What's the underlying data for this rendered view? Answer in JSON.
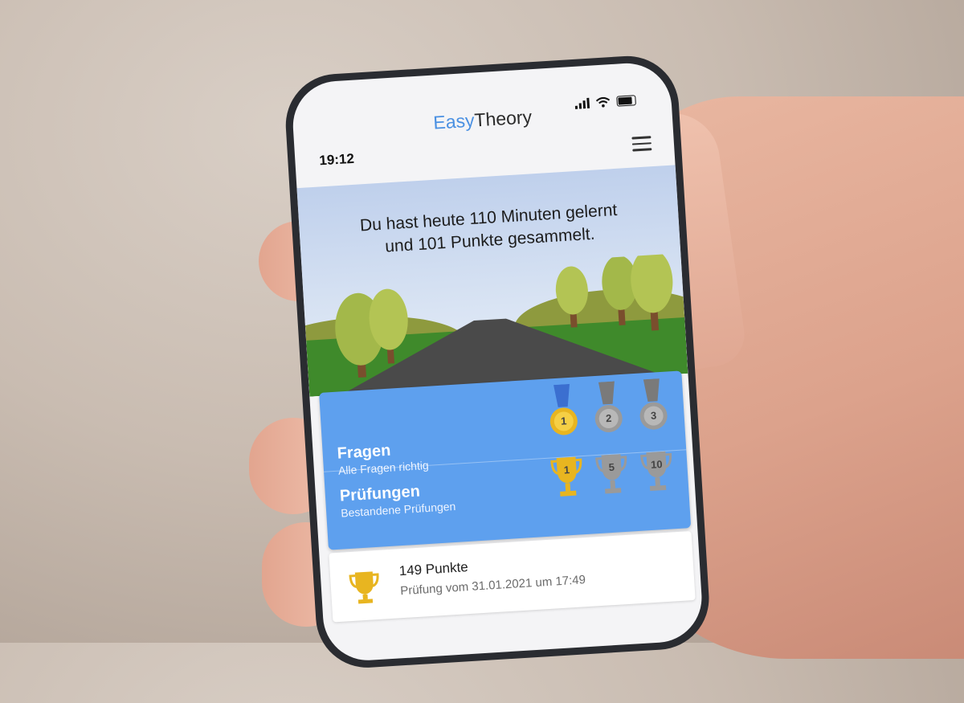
{
  "status_bar": {
    "time": "19:12"
  },
  "header": {
    "title_part1": "Easy",
    "title_part2": "Theory"
  },
  "banner": {
    "line1": "Du hast heute 110 Minuten gelernt",
    "line2": "und 101 Punkte gesammelt."
  },
  "achievements": {
    "rows": [
      {
        "title": "Fragen",
        "subtitle": "Alle Fragen richtig",
        "badges": [
          {
            "label": "1",
            "type": "medal",
            "color": "#e8b520",
            "earned": true
          },
          {
            "label": "2",
            "type": "medal",
            "color": "#9a9a9a",
            "earned": false
          },
          {
            "label": "3",
            "type": "medal",
            "color": "#9a9a9a",
            "earned": false
          }
        ]
      },
      {
        "title": "Prüfungen",
        "subtitle": "Bestandene Prüfungen",
        "badges": [
          {
            "label": "1",
            "type": "trophy",
            "color": "#e8b520",
            "earned": true
          },
          {
            "label": "5",
            "type": "trophy",
            "color": "#9a9a9a",
            "earned": false
          },
          {
            "label": "10",
            "type": "trophy",
            "color": "#9a9a9a",
            "earned": false
          }
        ]
      }
    ]
  },
  "history": [
    {
      "title": "149 Punkte",
      "subtitle": "Prüfung vom 31.01.2021 um 17:49",
      "icon": "trophy-icon"
    }
  ],
  "colors": {
    "accent": "#4a90e2",
    "card_blue": "#5ea0ee",
    "gold": "#e8b520",
    "silver": "#9a9a9a"
  }
}
